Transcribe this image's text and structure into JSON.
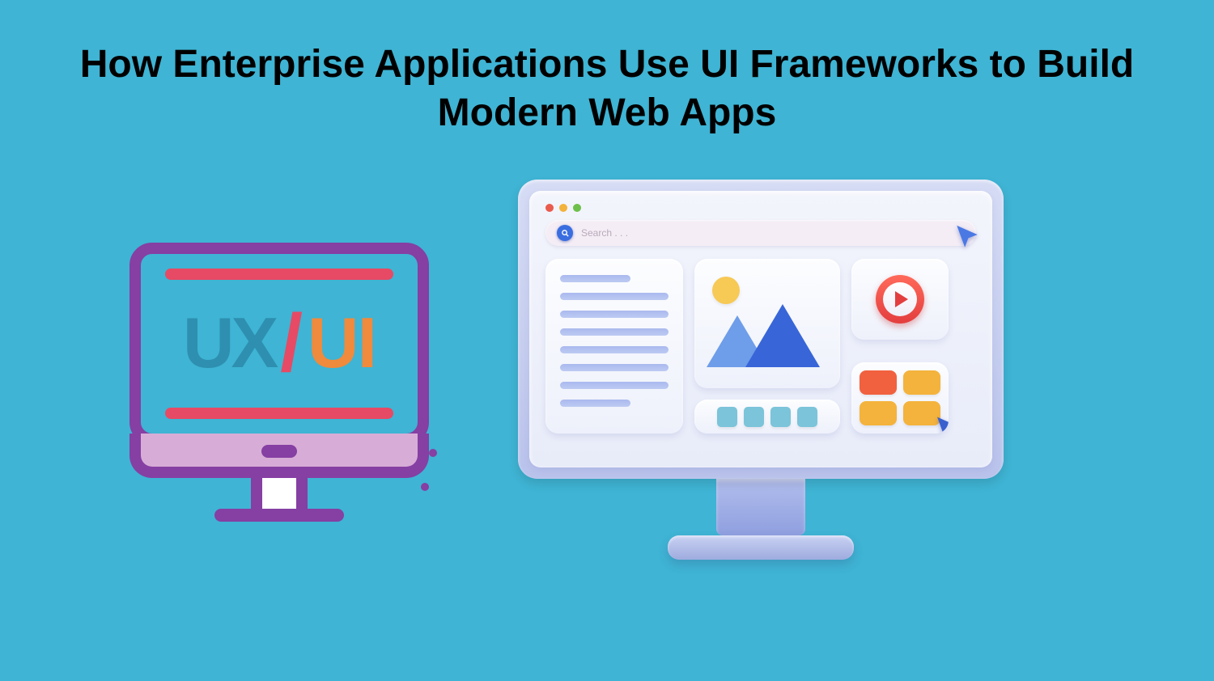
{
  "title": "How Enterprise Applications Use UI Frameworks to Build Modern Web Apps",
  "left_monitor": {
    "ux_label": "UX",
    "slash": "/",
    "ui_label": "UI"
  },
  "right_monitor": {
    "search_placeholder": "Search . . .",
    "traffic_light_colors": {
      "red": "#e95b4c",
      "yellow": "#f3b23c",
      "green": "#6ec04a"
    }
  },
  "colors": {
    "background": "#3fb4d4",
    "purple": "#863fa3",
    "pink": "#e74a64",
    "orange": "#f08a3c"
  }
}
